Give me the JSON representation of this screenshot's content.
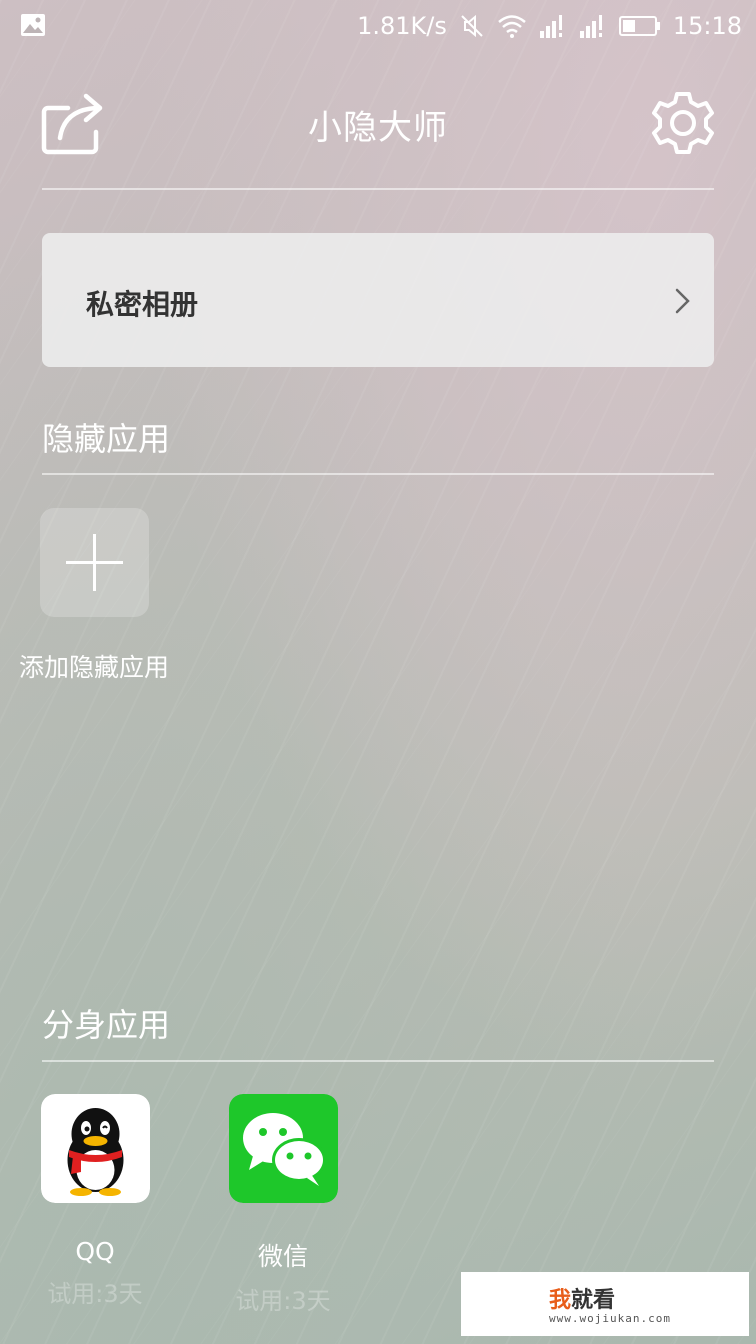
{
  "status_bar": {
    "speed": "1.81K/s",
    "time": "15:18",
    "icons": [
      "image-icon",
      "mute-icon",
      "wifi-icon",
      "signal-icon",
      "signal-icon",
      "battery-icon"
    ]
  },
  "header": {
    "title": "小隐大师",
    "icons": [
      "share-icon",
      "settings-icon"
    ]
  },
  "private_album": {
    "label": "私密相册",
    "icon": "chevron-right-icon"
  },
  "hidden_apps": {
    "section_title": "隐藏应用",
    "add_label": "添加隐藏应用",
    "add_icon": "plus-icon"
  },
  "clone_apps": {
    "section_title": "分身应用",
    "items": [
      {
        "name": "QQ",
        "trial": "试用:3天",
        "icon": "qq-penguin-icon"
      },
      {
        "name": "微信",
        "trial": "试用:3天",
        "icon": "wechat-icon"
      }
    ]
  },
  "watermark": {
    "logo_a": "我",
    "logo_b": "就看",
    "url": "www.wojiukan.com"
  },
  "colors": {
    "wechat_green": "#1ec72a",
    "qq_scarf_red": "#e02020",
    "card_bg": "#ececec"
  }
}
